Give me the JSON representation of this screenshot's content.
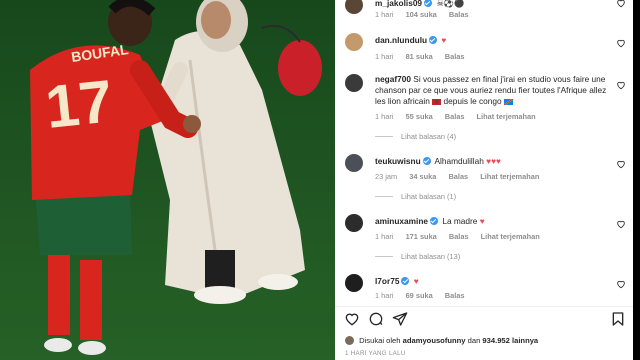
{
  "photo": {
    "jersey_name": "BOUFAL",
    "jersey_number": "17",
    "colors": {
      "pitch": "#1c5a22",
      "shirt": "#d8261f",
      "shorts": "#1f5f35",
      "robe": "#e9e2d6"
    }
  },
  "comments": [
    {
      "user": "m_jakolis09",
      "verified": true,
      "text": "",
      "emoji": "☠⚽⚫",
      "time": "1 hari",
      "likes": "104 suka",
      "reply": "Balas",
      "translate": "",
      "replies": ""
    },
    {
      "user": "dan.nlundulu",
      "verified": true,
      "text": "",
      "emoji": "♥",
      "time": "1 hari",
      "likes": "81 suka",
      "reply": "Balas",
      "translate": "",
      "replies": ""
    },
    {
      "user": "negaf700",
      "verified": false,
      "text": "Si vous passez en final j'irai en studio vous faire une chanson par ce que vous auriez rendu fier toutes l'Afrique allez les lion africain",
      "text_after": "depuis le congo",
      "time": "1 hari",
      "likes": "55 suka",
      "reply": "Balas",
      "translate": "Lihat terjemahan",
      "replies": "Lihat balasan (4)"
    },
    {
      "user": "teukuwisnu",
      "verified": true,
      "text": "Alhamdulillah",
      "emoji": "♥♥♥",
      "time": "23 jam",
      "likes": "34 suka",
      "reply": "Balas",
      "translate": "Lihat terjemahan",
      "replies": "Lihat balasan (1)"
    },
    {
      "user": "aminuxamine",
      "verified": true,
      "text": "La madre",
      "emoji": "♥",
      "time": "1 hari",
      "likes": "171 suka",
      "reply": "Balas",
      "translate": "Lihat terjemahan",
      "replies": "Lihat balasan (13)"
    },
    {
      "user": "l7or75",
      "verified": true,
      "text": "",
      "emoji": "♥",
      "time": "1 hari",
      "likes": "69 suka",
      "reply": "Balas",
      "translate": "",
      "replies": ""
    }
  ],
  "footer": {
    "liked_prefix": "Disukai oleh",
    "liked_user": "adamyousofunny",
    "liked_middle": "dan",
    "liked_count": "934.952 lainnya",
    "post_time": "1 HARI YANG LALU"
  },
  "icons": {
    "like": "heart-icon",
    "comment": "comment-icon",
    "share": "share-icon",
    "save": "bookmark-icon"
  },
  "accent": {
    "verified": "#3897f0",
    "heart": "#ed4956",
    "muted": "#8e8e8e"
  }
}
